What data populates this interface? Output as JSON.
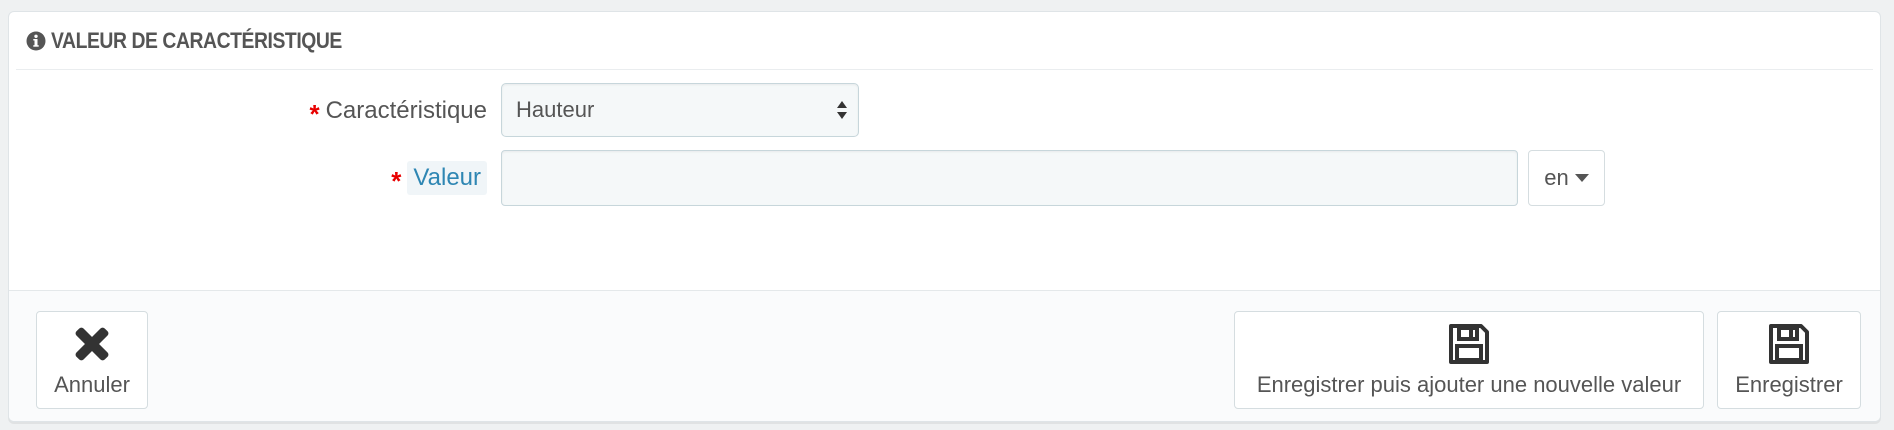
{
  "panel": {
    "title": "VALEUR DE CARACTÉRISTIQUE",
    "title_icon": "info-circle-icon"
  },
  "form": {
    "feature": {
      "label": "Caractéristique",
      "required_mark": "*",
      "selected": "Hauteur"
    },
    "value": {
      "label": "Valeur",
      "required_mark": "*",
      "current_value": "",
      "placeholder": ""
    },
    "language": {
      "selected": "en"
    }
  },
  "footer": {
    "cancel_label": "Annuler",
    "cancel_icon": "close-icon",
    "save_and_add_label": "Enregistrer puis ajouter une nouvelle valeur",
    "save_and_add_icon": "floppy-disk-icon",
    "save_label": "Enregistrer",
    "save_icon": "floppy-disk-icon"
  },
  "colors": {
    "required": "#e80000",
    "link": "#2e86b3",
    "text": "#555555"
  }
}
